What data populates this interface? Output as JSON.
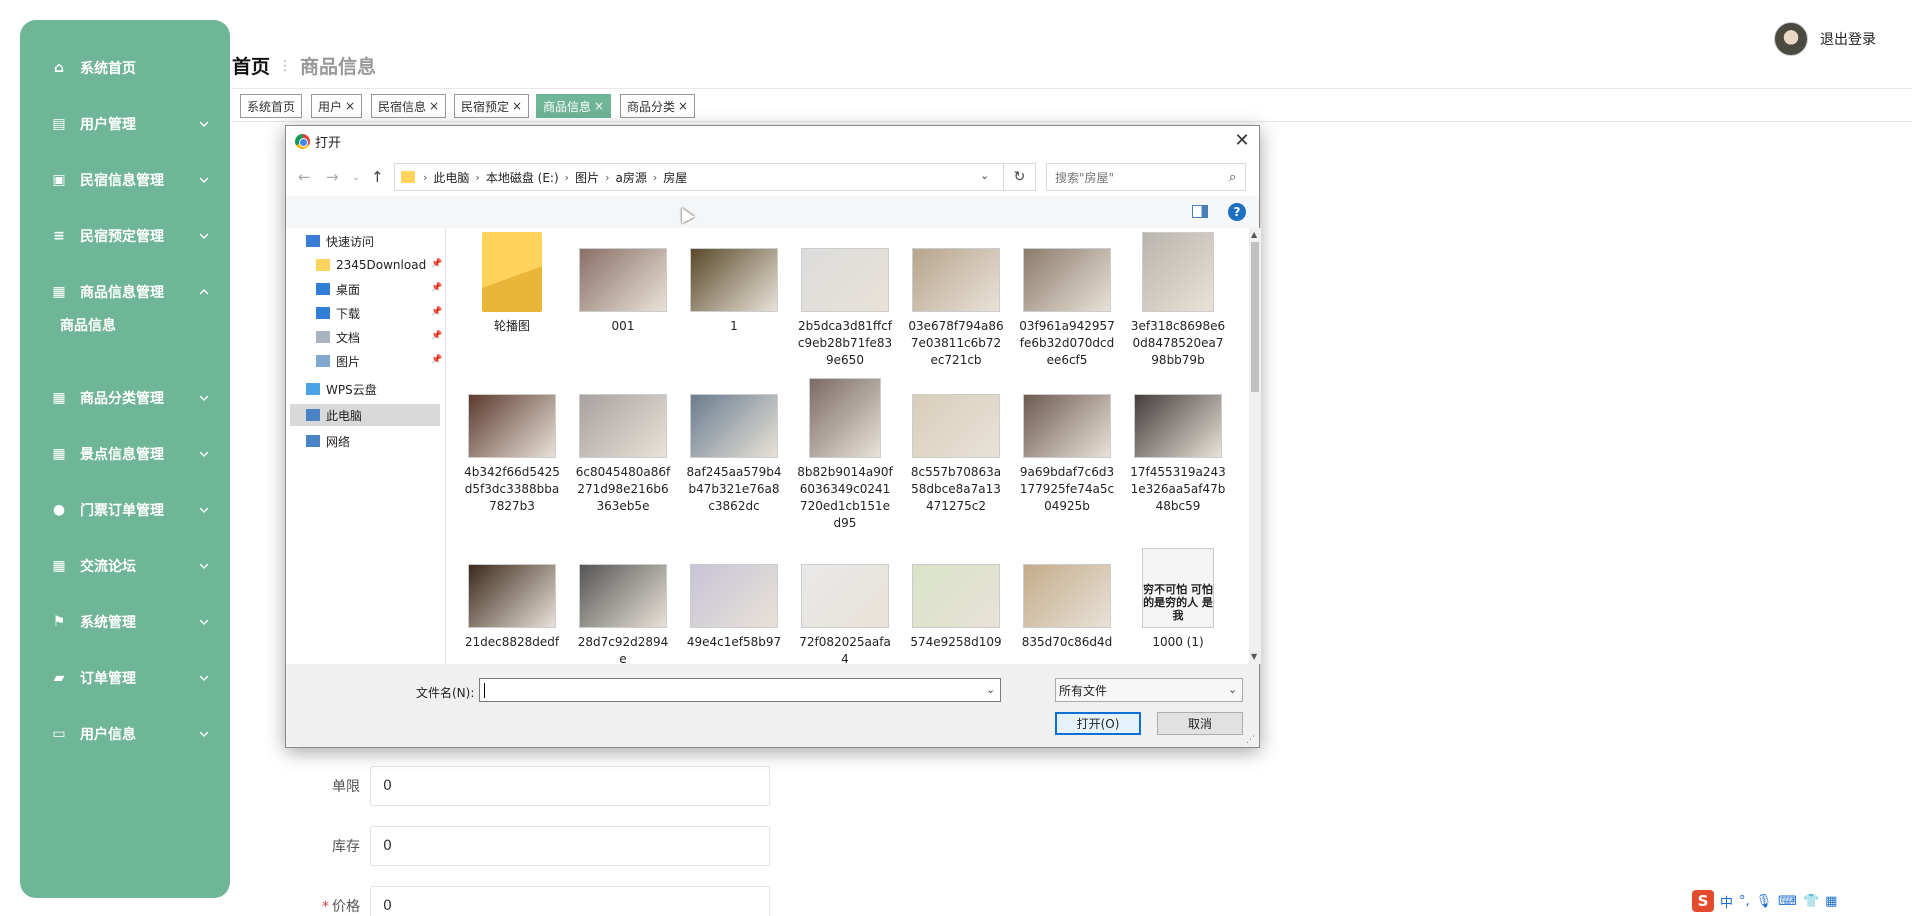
{
  "sidebar": {
    "items": [
      {
        "label": "系统首页",
        "icon": "home-icon"
      },
      {
        "label": "用户管理",
        "icon": "clipboard-icon"
      },
      {
        "label": "民宿信息管理",
        "icon": "clipboard-check-icon"
      },
      {
        "label": "民宿预定管理",
        "icon": "list-icon"
      },
      {
        "label": "商品信息管理",
        "icon": "grid-icon"
      },
      {
        "label": "商品分类管理",
        "icon": "grid-icon"
      },
      {
        "label": "景点信息管理",
        "icon": "grid-icon"
      },
      {
        "label": "门票订单管理",
        "icon": "bulb-icon"
      },
      {
        "label": "交流论坛",
        "icon": "grid-icon"
      },
      {
        "label": "系统管理",
        "icon": "flag-icon"
      },
      {
        "label": "订单管理",
        "icon": "briefcase-icon"
      },
      {
        "label": "用户信息",
        "icon": "card-icon"
      }
    ],
    "sub_item": "商品信息"
  },
  "header": {
    "breadcrumb_home": "首页",
    "breadcrumb_current": "商品信息",
    "logout": "退出登录"
  },
  "tabs": [
    {
      "label": "系统首页",
      "closable": false
    },
    {
      "label": "用户",
      "closable": true
    },
    {
      "label": "民宿信息",
      "closable": true
    },
    {
      "label": "民宿预定",
      "closable": true
    },
    {
      "label": "商品信息",
      "closable": true,
      "active": true
    },
    {
      "label": "商品分类",
      "closable": true
    }
  ],
  "form": {
    "rows": [
      {
        "label": "单限",
        "value": "0",
        "required": false
      },
      {
        "label": "库存",
        "value": "0",
        "required": false
      },
      {
        "label": "价格",
        "value": "0",
        "required": true
      }
    ]
  },
  "dialog": {
    "title": "打开",
    "path": [
      "此电脑",
      "本地磁盘 (E:)",
      "图片",
      "a房源",
      "房屋"
    ],
    "search_placeholder": "搜索\"房屋\"",
    "nav_tree": [
      {
        "label": "快速访问",
        "pinned": false
      },
      {
        "label": "2345Download",
        "pinned": true
      },
      {
        "label": "桌面",
        "pinned": true
      },
      {
        "label": "下载",
        "pinned": true
      },
      {
        "label": "文档",
        "pinned": true
      },
      {
        "label": "图片",
        "pinned": true
      },
      {
        "label": "WPS云盘",
        "pinned": false
      },
      {
        "label": "此电脑",
        "pinned": false,
        "selected": true
      },
      {
        "label": "网络",
        "pinned": false
      }
    ],
    "files": [
      {
        "name": "轮播图",
        "kind": "folder"
      },
      {
        "name": "001",
        "kind": "image",
        "color": "#8a6f66"
      },
      {
        "name": "1",
        "kind": "image",
        "color": "#5a4a2a"
      },
      {
        "name": "2b5dca3d81ffcfc9eb28b71fe839e650",
        "kind": "image",
        "color": "#dcdcdc"
      },
      {
        "name": "03e678f794a867e03811c6b72ec721cb",
        "kind": "image",
        "color": "#b7a48c"
      },
      {
        "name": "03f961a942957fe6b32d070dcdee6cf5",
        "kind": "image",
        "color": "#8c7b6c"
      },
      {
        "name": "3ef318c8698e60d8478520ea798bb79b",
        "kind": "image",
        "color": "#b9b4ad"
      },
      {
        "name": "4b342f66d5425d5f3dc3388bba7827b3",
        "kind": "image",
        "color": "#5e3b2f"
      },
      {
        "name": "6c8045480a86f271d98e216b6363eb5e",
        "kind": "image",
        "color": "#a7a2a0"
      },
      {
        "name": "8af245aa579b4b47b321e76a8c3862dc",
        "kind": "image",
        "color": "#6b7d8e"
      },
      {
        "name": "8b82b9014a90f6036349c0241720ed1cb151ed95",
        "kind": "image",
        "color": "#7a6a66"
      },
      {
        "name": "8c557b70863a58dbce8a7a13471275c2",
        "kind": "image",
        "color": "#d8cdb9"
      },
      {
        "name": "9a69bdaf7c6d3177925fe74a5c04925b",
        "kind": "image",
        "color": "#6e5b52"
      },
      {
        "name": "17f455319a2431e326aa5af47b48bc59",
        "kind": "image",
        "color": "#433d3d"
      },
      {
        "name": "21dec8828dedf",
        "kind": "image",
        "color": "#3c2a1c"
      },
      {
        "name": "28d7c92d2894e",
        "kind": "image",
        "color": "#555"
      },
      {
        "name": "49e4c1ef58b97",
        "kind": "image",
        "color": "#c8c4d6"
      },
      {
        "name": "72f082025aafa4",
        "kind": "image",
        "color": "#e9e9e9"
      },
      {
        "name": "574e9258d109",
        "kind": "image",
        "color": "#d9e3c7"
      },
      {
        "name": "835d70c86d4d",
        "kind": "image",
        "color": "#c4ab8a"
      },
      {
        "name": "1000 (1)",
        "kind": "image",
        "color": "#f2f2f2",
        "text": "穷不可怕 可怕的是穷的人 是我"
      }
    ],
    "filename_label": "文件名(N):",
    "filename_value": "",
    "filetype": "所有文件",
    "open_button": "打开(O)",
    "cancel_button": "取消"
  },
  "ime": {
    "s": "S",
    "lang": "中"
  }
}
